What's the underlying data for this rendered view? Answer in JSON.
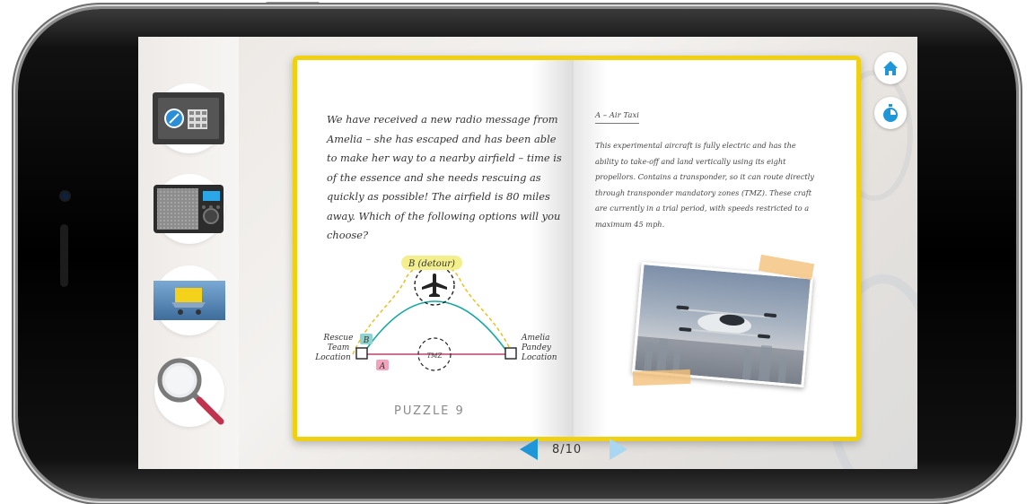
{
  "toolbar": {
    "items": [
      {
        "name": "safe-tool-button",
        "icon": "safe-icon"
      },
      {
        "name": "radio-tool-button",
        "icon": "radio-icon"
      },
      {
        "name": "cart-tool-button",
        "icon": "cart-icon"
      },
      {
        "name": "magnifier-tool-button",
        "icon": "magnifier-icon"
      }
    ]
  },
  "book": {
    "left_page": {
      "intro_text": "We have received a new radio message from Amelia – she has escaped and has been able to make her way to a nearby airfield – time is of the essence and she needs rescuing as quickly as possible! The airfield is 80 miles away. Which of the following options will you choose?",
      "diagram": {
        "route_b_label": "B (detour)",
        "b_label": "B",
        "a_label": "A",
        "tmz_label": "TMZ",
        "start_label_line1": "Rescue",
        "start_label_line2": "Team",
        "start_label_line3": "Location",
        "end_label_line1": "Amelia",
        "end_label_line2": "Pandey",
        "end_label_line3": "Location"
      },
      "puzzle_label": "PUZZLE 9"
    },
    "right_page": {
      "heading": "A – Air Taxi",
      "body": "This experimental aircraft is fully electric and has the ability to take-off and land vertically using its eight propellors. Contains a transponder, so it can route directly through transponder mandatory zones (TMZ). These craft are currently in a trial period, with speeds restricted to a maximum 45 mph."
    }
  },
  "pagination": {
    "label": "8/10",
    "current": 8,
    "total": 10
  },
  "colors": {
    "accent": "#1e96d8",
    "book_border": "#f0d012",
    "route_a": "#c2406a",
    "route_b": "#14a8a0",
    "detour": "#e8c21a"
  }
}
